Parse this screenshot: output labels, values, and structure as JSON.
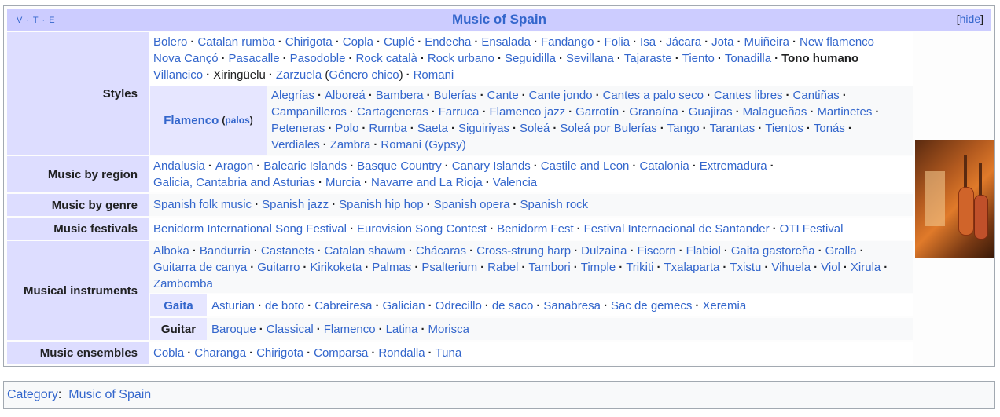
{
  "navbox": {
    "vte": "V · T · E",
    "title": "Music of Spain",
    "hide_open": "[",
    "hide_label": "hide",
    "hide_close": "]"
  },
  "groups": {
    "styles": {
      "label": "Styles",
      "items": [
        "Bolero",
        "Catalan rumba",
        "Chirigota",
        "Copla",
        "Cuplé",
        "Endecha",
        "Ensalada",
        "Fandango",
        "Folia",
        "Isa",
        "Jácara",
        "Jota",
        "Muiñeira",
        "New flamenco",
        "Nova Cançó",
        "Pasacalle",
        "Pasodoble",
        "Rock català",
        "Rock urbano",
        "Seguidilla",
        "Sevillana",
        "Tajaraste",
        "Tiento",
        "Tonadilla",
        "Tono humano",
        "Villancico",
        "Xiringüelu",
        "Zarzuela (Género chico)",
        "Romani"
      ],
      "line1": [
        "Bolero",
        "Catalan rumba",
        "Chirigota",
        "Copla",
        "Cuplé",
        "Endecha",
        "Ensalada",
        "Fandango",
        "Folia",
        "Isa",
        "Jácara",
        "Jota",
        "Muiñeira",
        "New flamenco"
      ],
      "line2": [
        "Nova Cançó",
        "Pasacalle",
        "Pasodoble",
        "Rock català",
        "Rock urbano",
        "Seguidilla",
        "Sevillana",
        "Tajaraste",
        "Tiento",
        "Tonadilla",
        "Tono humano"
      ],
      "line3_a": "Villancico",
      "line3_b": "Xiringüelu",
      "line3_c": "Zarzuela",
      "line3_d": "(",
      "line3_e": "Género chico",
      "line3_f": ")",
      "line3_g": "Romani"
    },
    "flamenco": {
      "label": "Flamenco",
      "sub_open": "(",
      "sub_label": "palos",
      "sub_close": ")",
      "line1": [
        "Alegrías",
        "Alboreá",
        "Bambera",
        "Bulerías",
        "Cante",
        "Cante jondo",
        "Cantes a palo seco",
        "Cantes libres",
        "Cantiñas"
      ],
      "line2": [
        "Campanilleros",
        "Cartageneras",
        "Farruca",
        "Flamenco jazz",
        "Garrotín",
        "Granaína",
        "Guajiras",
        "Malagueñas",
        "Martinetes"
      ],
      "line3": [
        "Peteneras",
        "Polo",
        "Rumba",
        "Saeta",
        "Siguiriyas",
        "Soleá",
        "Soleá por Bulerías",
        "Tango",
        "Tarantas",
        "Tientos",
        "Tonás"
      ],
      "line4": [
        "Verdiales",
        "Zambra",
        "Romani (Gypsy)"
      ]
    },
    "region": {
      "label": "Music by region",
      "line1": [
        "Andalusia",
        "Aragon",
        "Balearic Islands",
        "Basque Country",
        "Canary Islands",
        "Castile and Leon",
        "Catalonia",
        "Extremadura"
      ],
      "line2": [
        "Galicia, Cantabria and Asturias",
        "Murcia",
        "Navarre and La Rioja",
        "Valencia"
      ]
    },
    "genre": {
      "label": "Music by genre",
      "line1": [
        "Spanish folk music",
        "Spanish jazz",
        "Spanish hip hop",
        "Spanish opera",
        "Spanish rock"
      ]
    },
    "festivals": {
      "label": "Music festivals",
      "line1": [
        "Benidorm International Song Festival",
        "Eurovision Song Contest",
        "Benidorm Fest",
        "Festival Internacional de Santander",
        "OTI Festival"
      ]
    },
    "instruments": {
      "label": "Musical instruments",
      "line1": [
        "Alboka",
        "Bandurria",
        "Castanets",
        "Catalan shawm",
        "Chácaras",
        "Cross-strung harp",
        "Dulzaina",
        "Fiscorn",
        "Flabiol",
        "Gaita gastoreña",
        "Gralla"
      ],
      "line2": [
        "Guitarra de canya",
        "Guitarro",
        "Kirikoketa",
        "Palmas",
        "Psalterium",
        "Rabel",
        "Tambori",
        "Timple",
        "Trikiti",
        "Txalaparta",
        "Txistu",
        "Vihuela",
        "Viol",
        "Xirula"
      ],
      "line3": [
        "Zambomba"
      ]
    },
    "gaita": {
      "label": "Gaita",
      "line1": [
        "Asturian",
        "de boto",
        "Cabreiresa",
        "Galician",
        "Odrecillo",
        "de saco",
        "Sanabresa",
        "Sac de gemecs",
        "Xeremia"
      ]
    },
    "guitar": {
      "label": "Guitar",
      "line1": [
        "Baroque",
        "Classical",
        "Flamenco",
        "Latina",
        "Morisca"
      ]
    },
    "ensembles": {
      "label": "Music ensembles",
      "line1": [
        "Cobla",
        "Charanga",
        "Chirigota",
        "Comparsa",
        "Rondalla",
        "Tuna"
      ]
    }
  },
  "category": {
    "prefix": "Category",
    "colon": ":",
    "link": "Music of Spain"
  }
}
